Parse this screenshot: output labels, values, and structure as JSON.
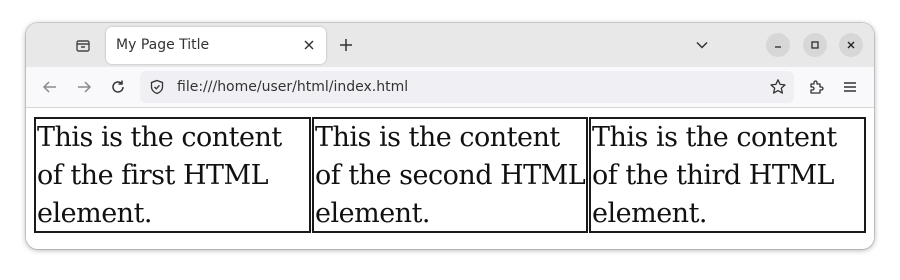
{
  "browser": {
    "tab": {
      "title": "My Page Title"
    },
    "url": "file:///home/user/html/index.html",
    "icons": {
      "tab_list": "tab-list-icon",
      "close_tab": "close-icon",
      "new_tab": "plus-icon",
      "list_all_tabs": "chevron-down-icon",
      "minimize": "minimize-icon",
      "maximize": "maximize-icon",
      "close_window": "close-icon",
      "back": "arrow-left-icon",
      "forward": "arrow-right-icon",
      "reload": "reload-icon",
      "site_info": "shield-icon",
      "bookmark": "star-icon",
      "extensions": "puzzle-icon",
      "menu": "hamburger-icon"
    }
  },
  "page": {
    "elements": [
      "This is the content of the first HTML element.",
      "This is the content of the second HTML element.",
      "This is the content of the third HTML element."
    ]
  }
}
